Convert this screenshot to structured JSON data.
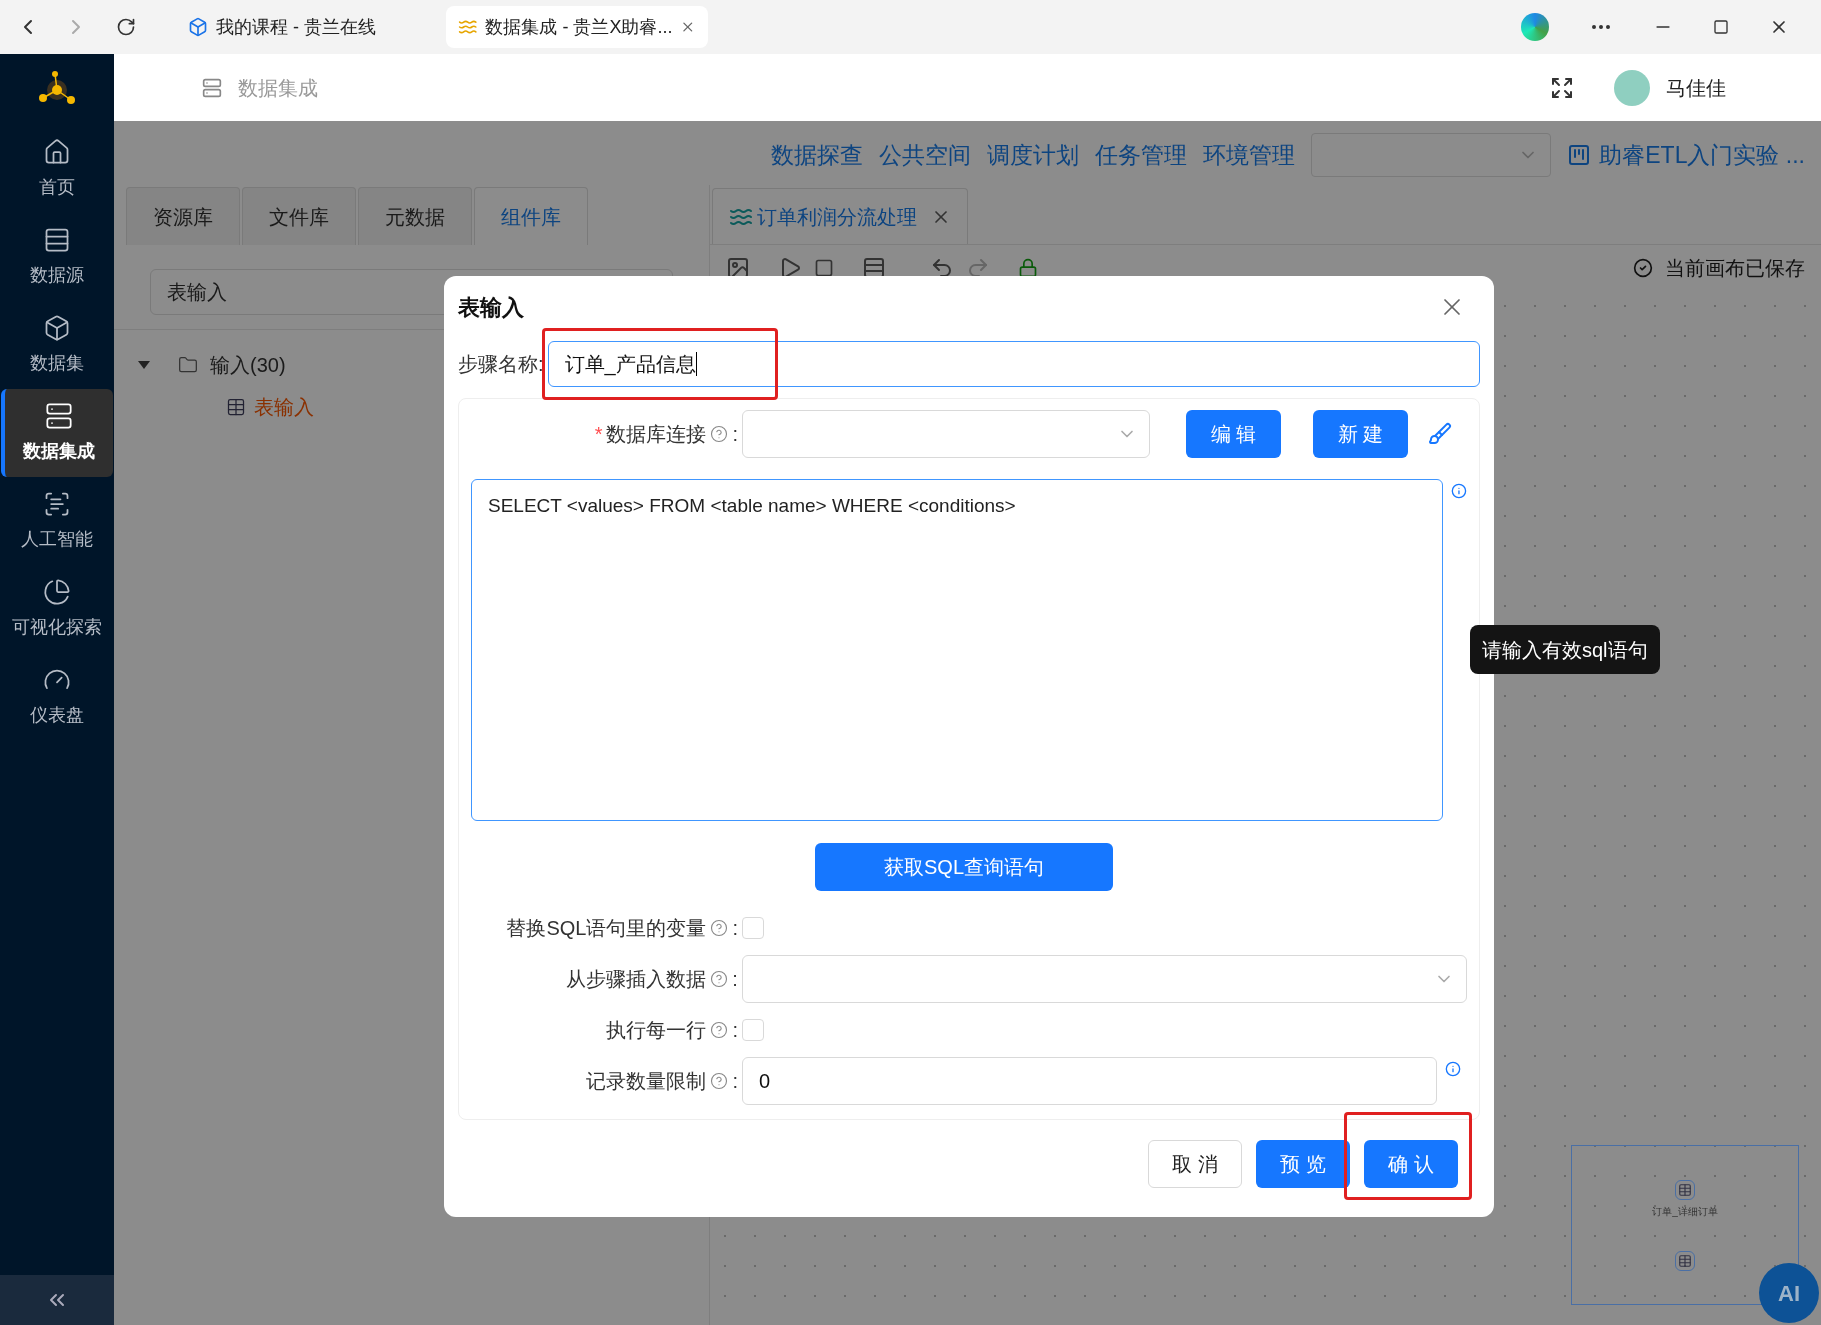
{
  "browser": {
    "tabs": [
      {
        "title": "我的课程 - 贵兰在线",
        "selected": false
      },
      {
        "title": "数据集成 - 贵兰X助睿...",
        "selected": true
      }
    ]
  },
  "header": {
    "breadcrumb": "数据集成",
    "user": "马佳佳"
  },
  "sidebar": {
    "items": [
      {
        "label": "首页",
        "selected": false
      },
      {
        "label": "数据源",
        "selected": false
      },
      {
        "label": "数据集",
        "selected": false
      },
      {
        "label": "数据集成",
        "selected": true
      },
      {
        "label": "人工智能",
        "selected": false
      },
      {
        "label": "可视化探索",
        "selected": false
      },
      {
        "label": "仪表盘",
        "selected": false
      }
    ]
  },
  "top_nav": {
    "links": [
      "数据探查",
      "公共空间",
      "调度计划",
      "任务管理",
      "环境管理"
    ],
    "project": "助睿ETL入门实验 ..."
  },
  "left_panel": {
    "tabs": [
      {
        "label": "资源库",
        "selected": false
      },
      {
        "label": "文件库",
        "selected": false
      },
      {
        "label": "元数据",
        "selected": false
      },
      {
        "label": "组件库",
        "selected": true
      }
    ],
    "search": "表输入",
    "tree": [
      {
        "label": "输入(30)",
        "expanded": true,
        "children": [
          {
            "label": "表输入",
            "selected": true
          }
        ]
      }
    ]
  },
  "canvas": {
    "tab": "订单利润分流处理",
    "saved_status": "当前画布已保存",
    "minimap_node": "订单_详细订单",
    "ai_button": "AI"
  },
  "dialog": {
    "title": "表输入",
    "step_name": {
      "label": "步骤名称:",
      "value": "订单_产品信息"
    },
    "db_connection": {
      "required_mark": "*",
      "label": "数据库连接",
      "colon": ":"
    },
    "db_buttons": [
      "编 辑",
      "新 建"
    ],
    "sql": "SELECT <values> FROM <table name> WHERE <conditions>",
    "get_sql_button": "获取SQL查询语句",
    "fields": [
      {
        "kind": "checkbox",
        "label": "替换SQL语句里的变量",
        "colon": ":",
        "checked": false
      },
      {
        "kind": "select",
        "label": "从步骤插入数据",
        "colon": ":"
      },
      {
        "kind": "checkbox",
        "label": "执行每一行",
        "colon": ":",
        "checked": false
      },
      {
        "kind": "input",
        "label": "记录数量限制",
        "colon": ":",
        "value": "0"
      }
    ],
    "footer_buttons": [
      {
        "label": "取 消",
        "kind": "default"
      },
      {
        "label": "预 览",
        "kind": "primary"
      },
      {
        "label": "确 认",
        "kind": "primary"
      }
    ]
  },
  "tooltip": "请输入有效sql语句"
}
